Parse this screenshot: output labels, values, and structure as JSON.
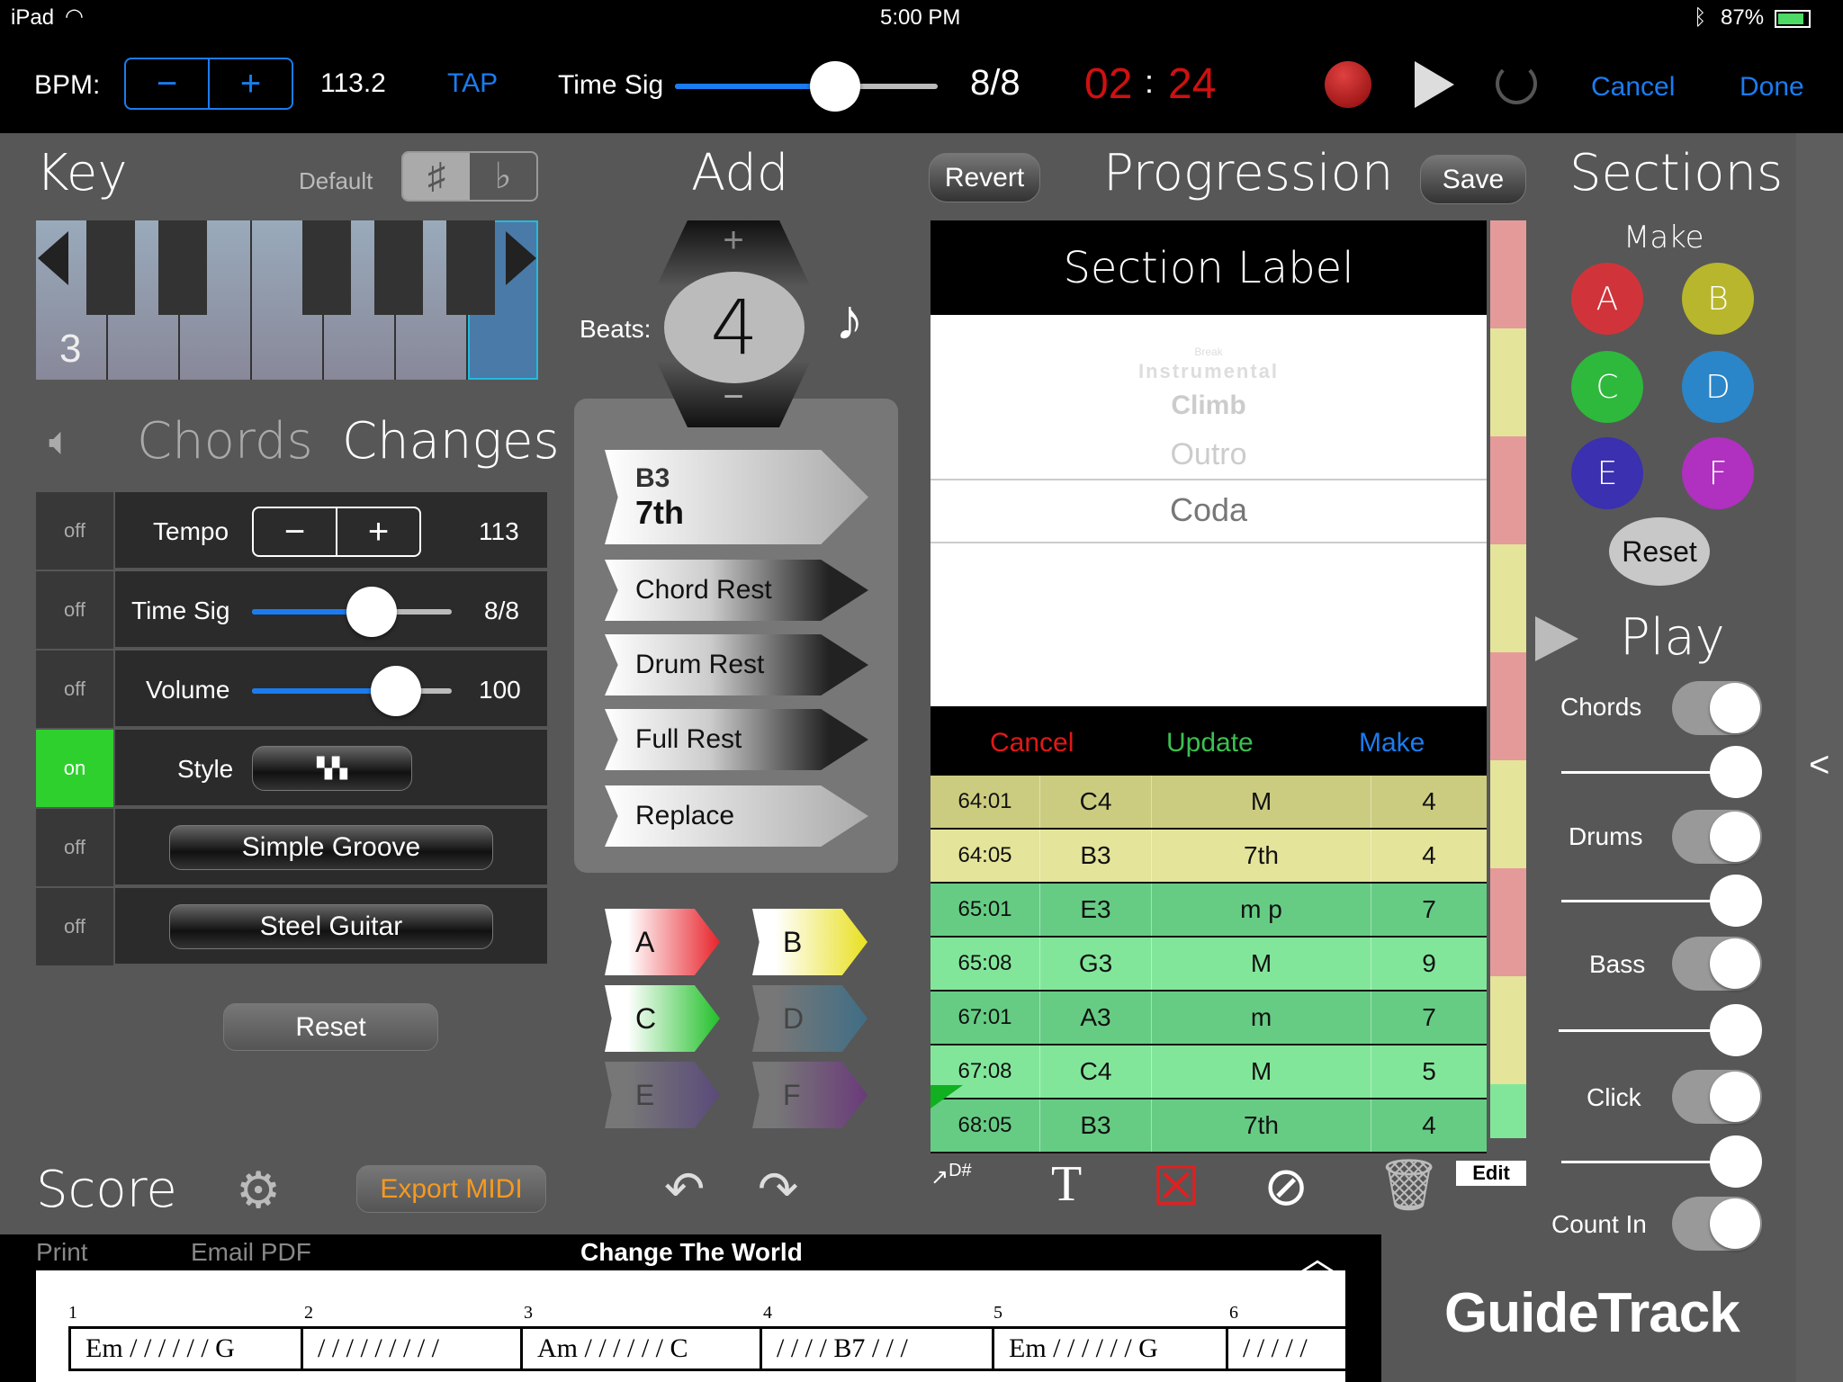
{
  "status_bar": {
    "device": "iPad",
    "time": "5:00 PM",
    "battery": "87%"
  },
  "toolbar": {
    "bpm_label": "BPM:",
    "bpm_minus": "−",
    "bpm_plus": "+",
    "bpm_value": "113.2",
    "tap": "TAP",
    "time_sig_label": "Time Sig",
    "time_sig_value": "8/8",
    "time_sig_level": 0.6,
    "timer_min": "02",
    "timer_sep": ":",
    "timer_sec": "24",
    "cancel": "Cancel",
    "done": "Done"
  },
  "key": {
    "title": "Key",
    "default_label": "Default",
    "sharp": "♯",
    "flat": "♭",
    "octave": "3"
  },
  "changes": {
    "chords_tab": "Chords",
    "changes_tab": "Changes",
    "rows": [
      {
        "state": "off",
        "label": "Tempo",
        "value": "113",
        "minus": "−",
        "plus": "+"
      },
      {
        "state": "off",
        "label": "Time Sig",
        "value": "8/8",
        "level": 0.6
      },
      {
        "state": "off",
        "label": "Volume",
        "value": "100",
        "level": 0.75
      },
      {
        "state": "on",
        "label": "Style"
      },
      {
        "state": "off",
        "button": "Simple Groove"
      },
      {
        "state": "off",
        "button": "Steel Guitar"
      }
    ],
    "reset": "Reset"
  },
  "score": {
    "title": "Score",
    "export": "Export MIDI",
    "print": "Print",
    "email": "Email PDF",
    "song_title": "Change The World",
    "measures": [
      {
        "n": "1",
        "text": "Em / / / / / / G"
      },
      {
        "n": "2",
        "text": "/ / / / / / / / /"
      },
      {
        "n": "3",
        "text": "Am / / / / / / C"
      },
      {
        "n": "4",
        "text": "/ / / / B7 / / /"
      },
      {
        "n": "5",
        "text": "Em / / / / / / G"
      },
      {
        "n": "6",
        "text": "/ / / / /"
      }
    ]
  },
  "add": {
    "title": "Add",
    "beats_label": "Beats:",
    "beats": "4",
    "chord_root": "B3",
    "chord_type": "7th",
    "chord_rest": "Chord Rest",
    "drum_rest": "Drum Rest",
    "full_rest": "Full Rest",
    "replace": "Replace",
    "sections": [
      {
        "l": "A",
        "c": "#e8242c"
      },
      {
        "l": "B",
        "c": "#e8e020"
      },
      {
        "l": "C",
        "c": "#22c02a"
      },
      {
        "l": "D",
        "c": "#3f6e86"
      },
      {
        "l": "E",
        "c": "#5a4a7a"
      },
      {
        "l": "F",
        "c": "#6a3a7a"
      }
    ]
  },
  "progression": {
    "revert": "Revert",
    "title": "Progression",
    "save": "Save",
    "section_label": "Section Label",
    "picker": [
      "Break",
      "Instrumental",
      "Climb",
      "Outro",
      "Coda"
    ],
    "cancel": "Cancel",
    "update": "Update",
    "make": "Make",
    "rows": [
      {
        "pos": "64:01",
        "root": "C4",
        "type": "M",
        "beats": "4",
        "bg": "#cccc80"
      },
      {
        "pos": "64:05",
        "root": "B3",
        "type": "7th",
        "beats": "4",
        "bg": "#e4e49a"
      },
      {
        "pos": "65:01",
        "root": "E3",
        "type": "m p",
        "beats": "7",
        "bg": "#66cc84"
      },
      {
        "pos": "65:08",
        "root": "G3",
        "type": "M",
        "beats": "9",
        "bg": "#82e69a"
      },
      {
        "pos": "67:01",
        "root": "A3",
        "type": "m",
        "beats": "7",
        "bg": "#66cc84"
      },
      {
        "pos": "67:08",
        "root": "C4",
        "type": "M",
        "beats": "5",
        "bg": "#82e69a"
      },
      {
        "pos": "68:05",
        "root": "B3",
        "type": "7th",
        "beats": "4",
        "bg": "#66cc84"
      }
    ],
    "strip_colors": [
      "#e59a9a",
      "#e4e49a",
      "#e59a9a",
      "#e4e49a",
      "#e59a9a",
      "#e4e49a",
      "#82e69a"
    ],
    "transpose_icon": "D#",
    "edit": "Edit"
  },
  "sections": {
    "title": "Sections",
    "make": "Make",
    "buttons": [
      {
        "l": "A",
        "c": "#d0343a",
        "t": "#fff"
      },
      {
        "l": "B",
        "c": "#b8b62c",
        "t": "#fff"
      },
      {
        "l": "C",
        "c": "#2eb83c",
        "t": "#fff"
      },
      {
        "l": "D",
        "c": "#2a86c8",
        "t": "#fff"
      },
      {
        "l": "E",
        "c": "#3a30b0",
        "t": "#fff"
      },
      {
        "l": "F",
        "c": "#b030c0",
        "t": "#fff"
      }
    ],
    "reset": "Reset"
  },
  "play": {
    "title": "Play",
    "chords": "Chords",
    "drums": "Drums",
    "bass": "Bass",
    "click": "Click",
    "count_in": "Count In",
    "collapse": "<"
  },
  "logo": "GuideTrack"
}
